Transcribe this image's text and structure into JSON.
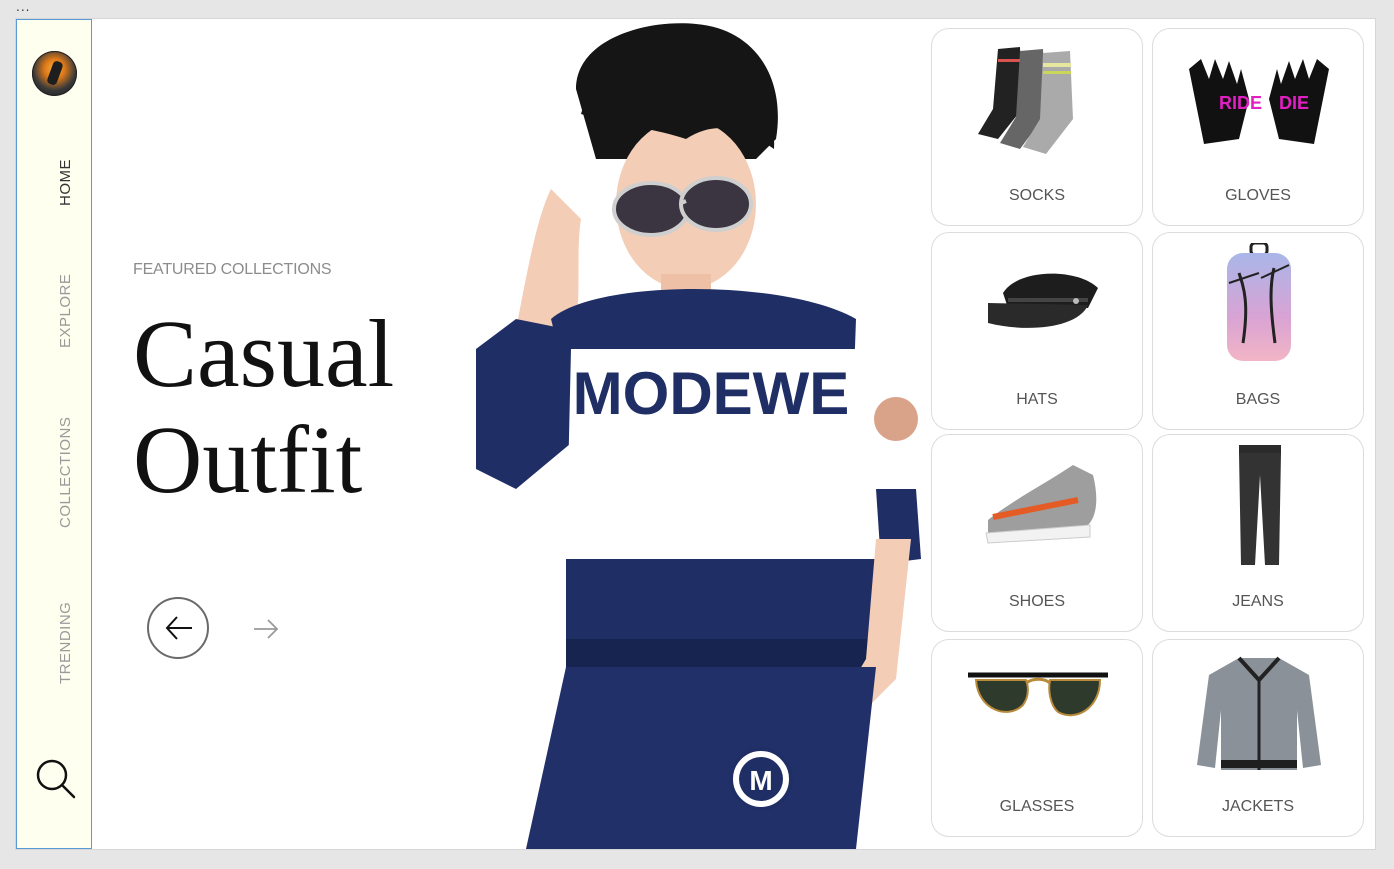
{
  "window": {
    "menu_dots": "..."
  },
  "sidebar": {
    "items": [
      {
        "label": "HOME",
        "active": true
      },
      {
        "label": "EXPLORE",
        "active": false
      },
      {
        "label": "COLLECTIONS",
        "active": false
      },
      {
        "label": "TRENDING",
        "active": false
      }
    ],
    "search_icon": "search-icon",
    "accent_border": "#5b9bd5",
    "background": "#fffff0"
  },
  "hero": {
    "eyebrow": "FEATURED COLLECTIONS",
    "title_line1": "Casual",
    "title_line2": "Outfit",
    "shirt_text": "MODEWE",
    "badge_letter": "M",
    "prev_icon": "arrow-left-icon",
    "next_icon": "arrow-right-icon"
  },
  "categories": [
    {
      "label": "SOCKS"
    },
    {
      "label": "GLOVES"
    },
    {
      "label": "HATS"
    },
    {
      "label": "BAGS"
    },
    {
      "label": "SHOES"
    },
    {
      "label": "JEANS"
    },
    {
      "label": "GLASSES"
    },
    {
      "label": "JACKETS"
    }
  ],
  "colors": {
    "navy": "#1f2f66",
    "title": "#111111"
  }
}
